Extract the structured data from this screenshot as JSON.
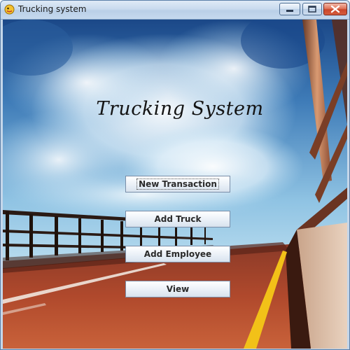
{
  "window": {
    "title": "Trucking system",
    "icon": "java-duke-icon"
  },
  "controls": {
    "minimize": "minimize-icon",
    "maximize": "maximize-icon",
    "close": "close-icon"
  },
  "main": {
    "heading": "Trucking System",
    "buttons": {
      "new_transaction": "New Transaction",
      "add_truck": "Add Truck",
      "add_employee": "Add Employee",
      "view": "View"
    },
    "focused_button": "New Transaction"
  },
  "colors": {
    "sky_top": "#1f4f8e",
    "sky_bottom": "#a9d6ee",
    "road": "#a8442a",
    "lane_marking": "#f2c118"
  }
}
